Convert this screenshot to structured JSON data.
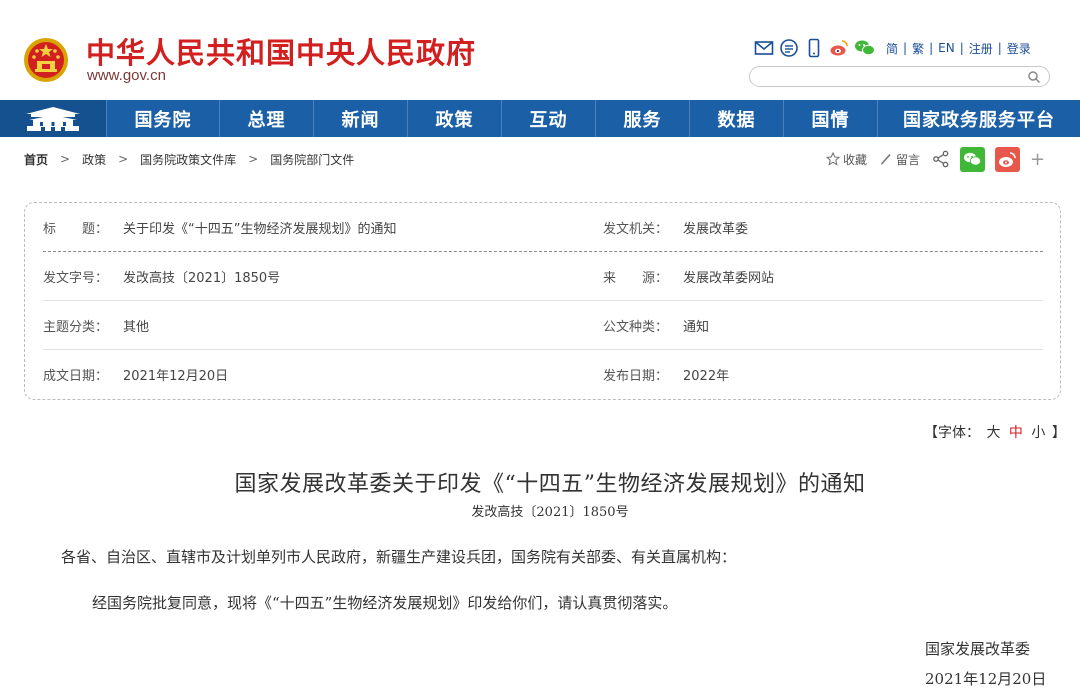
{
  "header": {
    "site_name": "中华人民共和国中央人民政府",
    "site_domain": "www.gov.cn",
    "languages": [
      {
        "label": "简"
      },
      {
        "label": "繁"
      },
      {
        "label": "EN"
      },
      {
        "label": "注册"
      },
      {
        "label": "登录"
      }
    ],
    "separator": "|",
    "search": {
      "value": "",
      "placeholder": ""
    }
  },
  "nav": {
    "items": [
      {
        "label": "国务院"
      },
      {
        "label": "总理"
      },
      {
        "label": "新闻"
      },
      {
        "label": "政策"
      },
      {
        "label": "互动"
      },
      {
        "label": "服务"
      },
      {
        "label": "数据"
      },
      {
        "label": "国情"
      },
      {
        "label": "国家政务服务平台"
      }
    ]
  },
  "breadcrumb": {
    "items": [
      {
        "label": "首页"
      },
      {
        "label": "政策"
      },
      {
        "label": "国务院政策文件库"
      },
      {
        "label": "国务院部门文件"
      }
    ],
    "arrow": ">"
  },
  "tools": {
    "favorite_label": "收藏",
    "comment_label": "留言",
    "plus": "+"
  },
  "info": {
    "rows": [
      {
        "left_label": "标　　题：",
        "left_value": "关于印发《“十四五”生物经济发展规划》的通知",
        "right_label": "发文机关：",
        "right_value": "发展改革委"
      },
      {
        "left_label": "发文字号：",
        "left_value": "发改高技〔2021〕1850号",
        "right_label": "来　　源：",
        "right_value": "发展改革委网站"
      },
      {
        "left_label": "主题分类：",
        "left_value": "其他",
        "right_label": "公文种类：",
        "right_value": "通知"
      },
      {
        "left_label": "成文日期：",
        "left_value": "2021年12月20日",
        "right_label": "发布日期：",
        "right_value": "2022年"
      }
    ]
  },
  "font_size": {
    "prefix": "【字体：",
    "large": "大",
    "medium": "中",
    "small": "小",
    "suffix": "】"
  },
  "article": {
    "title": "国家发展改革委关于印发《“十四五”生物经济发展规划》的通知",
    "doc_number": "发改高技〔2021〕1850号",
    "paragraphs": [
      "各省、自治区、直辖市及计划单列市人民政府，新疆生产建设兵团，国务院有关部委、有关直属机构：",
      "经国务院批复同意，现将《“十四五”生物经济发展规划》印发给你们，请认真贯彻落实。"
    ],
    "signature": "国家发展改革委",
    "date": "2021年12月20日"
  },
  "colors": {
    "brand_red": "#d21f1f",
    "nav_blue": "#1b5fa7",
    "link_blue": "#1a4e97",
    "wechat_green": "#3fb838",
    "weibo_red": "#e8584a"
  },
  "icons": [
    "national-emblem-icon",
    "email-icon",
    "message-icon",
    "mobile-icon",
    "weibo-icon",
    "wechat-icon",
    "search-icon",
    "star-icon",
    "pencil-icon",
    "share-icon",
    "tiananmen-icon"
  ]
}
